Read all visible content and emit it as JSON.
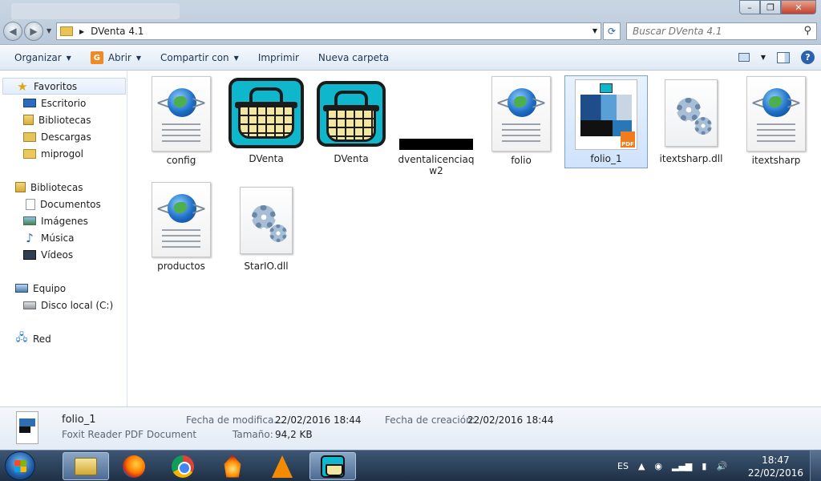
{
  "window": {
    "minimize_glyph": "–",
    "maximize_glyph": "❐",
    "close_glyph": "✕"
  },
  "address": {
    "path": "DVenta 4.1",
    "search_placeholder": "Buscar DVenta 4.1"
  },
  "toolbar": {
    "organize": "Organizar",
    "open": "Abrir",
    "share": "Compartir con",
    "print": "Imprimir",
    "new_folder": "Nueva carpeta"
  },
  "sidebar": {
    "favorites": "Favoritos",
    "escritorio": "Escritorio",
    "bibliotecas_fav": "Bibliotecas",
    "descargas": "Descargas",
    "miprogol": "miprogol",
    "bibliotecas": "Bibliotecas",
    "documentos": "Documentos",
    "imagenes": "Imágenes",
    "musica": "Música",
    "videos": "Vídeos",
    "equipo": "Equipo",
    "disco": "Disco local (C:)",
    "red": "Red"
  },
  "files": [
    {
      "name": "config",
      "icon": "xml-document-icon"
    },
    {
      "name": "DVenta",
      "icon": "dventa-app-icon"
    },
    {
      "name": "DVenta",
      "icon": "dventa-app-icon"
    },
    {
      "name": "dventalicenciaqw2",
      "icon": "redacted-thumbnail"
    },
    {
      "name": "folio",
      "icon": "xml-document-icon"
    },
    {
      "name": "folio_1",
      "icon": "pdf-thumbnail-icon"
    },
    {
      "name": "itextsharp.dll",
      "icon": "dll-gears-icon"
    },
    {
      "name": "itextsharp",
      "icon": "xml-document-icon"
    },
    {
      "name": "productos",
      "icon": "xml-document-icon"
    },
    {
      "name": "StarIO.dll",
      "icon": "dll-gears-icon"
    }
  ],
  "details": {
    "name": "folio_1",
    "type": "Foxit Reader PDF Document",
    "modified_label": "Fecha de modifica...",
    "modified_value": "22/02/2016 18:44",
    "created_label": "Fecha de creación:",
    "created_value": "22/02/2016 18:44",
    "size_label": "Tamaño:",
    "size_value": "94,2 KB"
  },
  "taskbar": {
    "language": "ES",
    "time": "18:47",
    "date": "22/02/2016"
  }
}
